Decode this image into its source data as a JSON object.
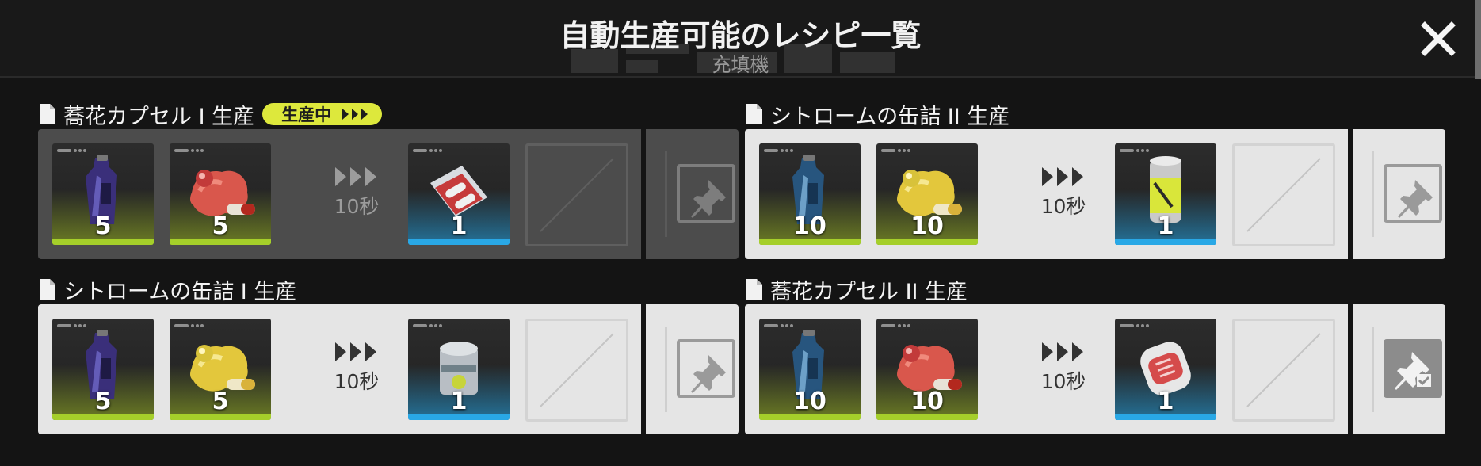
{
  "header": {
    "title": "自動生産可能のレシピ一覧",
    "subtitle": "充填機"
  },
  "colors": {
    "accent_yellow": "#dde83c",
    "input_bar": "#a5cf2a",
    "output_bar": "#29a8e6"
  },
  "recipes": [
    {
      "title": "蕎花カプセル I 生産",
      "status": "生産中",
      "inputs": [
        {
          "icon": "blue-bottle-icon",
          "qty": "5"
        },
        {
          "icon": "red-ore-capsule-icon",
          "qty": "5"
        }
      ],
      "time": "10秒",
      "output": {
        "icon": "capsule-blister-pack-icon",
        "qty": "1"
      },
      "pinned": false
    },
    {
      "title": "シトロームの缶詰 II 生産",
      "inputs": [
        {
          "icon": "blue-bottle-icon",
          "qty": "10"
        },
        {
          "icon": "yellow-ore-capsule-icon",
          "qty": "10"
        }
      ],
      "time": "10秒",
      "output": {
        "icon": "yellow-can-icon",
        "qty": "1"
      },
      "pinned": false
    },
    {
      "title": "シトロームの缶詰 I 生産",
      "inputs": [
        {
          "icon": "blue-bottle-icon",
          "qty": "5"
        },
        {
          "icon": "yellow-ore-capsule-icon",
          "qty": "5"
        }
      ],
      "time": "10秒",
      "output": {
        "icon": "tin-can-icon",
        "qty": "1"
      },
      "pinned": false
    },
    {
      "title": "蕎花カプセル II 生産",
      "inputs": [
        {
          "icon": "blue-bottle-icon",
          "qty": "10"
        },
        {
          "icon": "red-ore-capsule-icon",
          "qty": "10"
        }
      ],
      "time": "10秒",
      "output": {
        "icon": "capsule-case-icon",
        "qty": "1"
      },
      "pinned": true
    }
  ]
}
